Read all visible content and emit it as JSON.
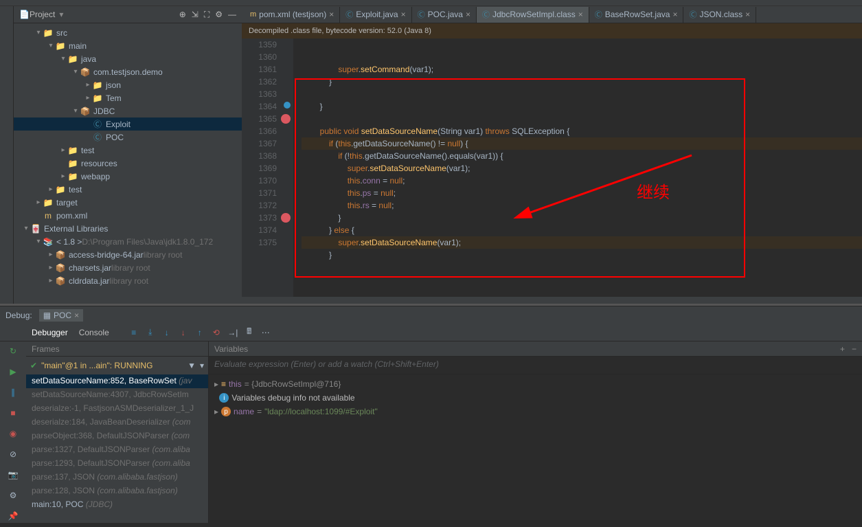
{
  "sidebar": {
    "title": "Project",
    "tree": [
      {
        "indent": 0,
        "arrow": "▾",
        "ico": "📁",
        "cls": "folder-open",
        "label": "src"
      },
      {
        "indent": 1,
        "arrow": "▾",
        "ico": "📁",
        "cls": "folder-open",
        "label": "main"
      },
      {
        "indent": 2,
        "arrow": "▾",
        "ico": "📁",
        "cls": "java-dir",
        "label": "java"
      },
      {
        "indent": 3,
        "arrow": "▾",
        "ico": "📦",
        "cls": "java-dir",
        "label": "com.testjson.demo"
      },
      {
        "indent": 4,
        "arrow": "▸",
        "ico": "📁",
        "cls": "folder",
        "label": "json"
      },
      {
        "indent": 4,
        "arrow": "▸",
        "ico": "📁",
        "cls": "folder",
        "label": "Tem"
      },
      {
        "indent": 3,
        "arrow": "▾",
        "ico": "📦",
        "cls": "java-dir",
        "label": "JDBC"
      },
      {
        "indent": 4,
        "arrow": "",
        "ico": "Ⓒ",
        "cls": "jfile",
        "label": "Exploit",
        "sel": true
      },
      {
        "indent": 4,
        "arrow": "",
        "ico": "Ⓒ",
        "cls": "jfile",
        "label": "POC"
      },
      {
        "indent": 2,
        "arrow": "▸",
        "ico": "📁",
        "cls": "folder",
        "label": "test"
      },
      {
        "indent": 2,
        "arrow": "",
        "ico": "📁",
        "cls": "folder",
        "label": "resources"
      },
      {
        "indent": 2,
        "arrow": "▸",
        "ico": "📁",
        "cls": "folder",
        "label": "webapp"
      },
      {
        "indent": 1,
        "arrow": "▸",
        "ico": "📁",
        "cls": "folder",
        "label": "test"
      },
      {
        "indent": 0,
        "arrow": "▸",
        "ico": "📁",
        "cls": "lname",
        "label": "target"
      },
      {
        "indent": 0,
        "arrow": "",
        "ico": "m",
        "cls": "mvn",
        "label": "pom.xml"
      },
      {
        "indent": -1,
        "arrow": "▾",
        "ico": "🀄",
        "cls": "lib",
        "label": "External Libraries",
        "top": true
      },
      {
        "indent": 0,
        "arrow": "▾",
        "ico": "📚",
        "cls": "lib",
        "label": "< 1.8 >",
        "path": "D:\\Program Files\\Java\\jdk1.8.0_172"
      },
      {
        "indent": 1,
        "arrow": "▸",
        "ico": "📦",
        "cls": "lib",
        "label": "access-bridge-64.jar",
        "dim": "library root"
      },
      {
        "indent": 1,
        "arrow": "▸",
        "ico": "📦",
        "cls": "lib",
        "label": "charsets.jar",
        "dim": "library root"
      },
      {
        "indent": 1,
        "arrow": "▸",
        "ico": "📦",
        "cls": "lib",
        "label": "cldrdata.jar",
        "dim": "library root"
      }
    ]
  },
  "tabs": [
    {
      "ico": "m",
      "cls": "mvn",
      "label": "pom.xml (testjson)"
    },
    {
      "ico": "Ⓒ",
      "cls": "jfile",
      "label": "Exploit.java"
    },
    {
      "ico": "Ⓒ",
      "cls": "jfile",
      "label": "POC.java"
    },
    {
      "ico": "Ⓒ",
      "cls": "jfile",
      "label": "JdbcRowSetImpl.class",
      "active": true
    },
    {
      "ico": "Ⓒ",
      "cls": "jfile",
      "label": "BaseRowSet.java"
    },
    {
      "ico": "Ⓒ",
      "cls": "jfile",
      "label": "JSON.class"
    }
  ],
  "banner": "Decompiled .class file, bytecode version: 52.0 (Java 8)",
  "gutter_start": 1359,
  "gutter_count": 17,
  "code_lines": [
    {
      "html": "                <span class='kw'>super</span>.<span class='fn'>setCommand</span>(var1);"
    },
    {
      "html": "            }"
    },
    {
      "html": ""
    },
    {
      "html": "        }"
    },
    {
      "html": ""
    },
    {
      "html": "        <span class='kw'>public void</span> <span class='fn'>setDataSourceName</span>(String var1) <span class='kw'>throws</span> SQLException {"
    },
    {
      "html": "            <span class='kw'>if</span> (<span class='kw'>this</span>.getDataSourceName() != <span class='lit'>null</span>) {",
      "hl": true
    },
    {
      "html": "                <span class='kw'>if</span> (!<span class='kw'>this</span>.getDataSourceName().equals(var1)) {"
    },
    {
      "html": "                    <span class='kw'>super</span>.<span class='fn'>setDataSourceName</span>(var1);"
    },
    {
      "html": "                    <span class='kw'>this</span>.<span class='id'>conn</span> = <span class='lit'>null</span>;"
    },
    {
      "html": "                    <span class='kw'>this</span>.<span class='id'>ps</span> = <span class='lit'>null</span>;"
    },
    {
      "html": "                    <span class='kw'>this</span>.<span class='id'>rs</span> = <span class='lit'>null</span>;"
    },
    {
      "html": "                }"
    },
    {
      "html": "            } <span class='kw'>else</span> {"
    },
    {
      "html": "                <span class='kw'>super</span>.<span class='fn'>setDataSourceName</span>(var1);",
      "hl": true
    },
    {
      "html": "            }"
    },
    {
      "html": ""
    }
  ],
  "annotation": "继续",
  "debug": {
    "title": "Debug:",
    "tab": "POC",
    "tabs": [
      "Debugger",
      "Console"
    ],
    "frames_title": "Frames",
    "vars_title": "Variables",
    "frame_sel": "\"main\"@1 in ...ain\": RUNNING",
    "frames": [
      {
        "label": "setDataSourceName:852, BaseRowSet",
        "pkg": "(jav",
        "sel": true
      },
      {
        "label": "setDataSourceName:4307, JdbcRowSetIm",
        "dim": true
      },
      {
        "label": "deserialze:-1, FastjsonASMDeserializer_1_J",
        "dim": true
      },
      {
        "label": "deserialze:184, JavaBeanDeserializer",
        "pkg": "(com",
        "dim": true
      },
      {
        "label": "parseObject:368, DefaultJSONParser",
        "pkg": "(com",
        "dim": true
      },
      {
        "label": "parse:1327, DefaultJSONParser",
        "pkg": "(com.aliba",
        "dim": true
      },
      {
        "label": "parse:1293, DefaultJSONParser",
        "pkg": "(com.aliba",
        "dim": true
      },
      {
        "label": "parse:137, JSON",
        "pkg": "(com.alibaba.fastjson)",
        "dim": true
      },
      {
        "label": "parse:128, JSON",
        "pkg": "(com.alibaba.fastjson)",
        "dim": true
      },
      {
        "label": "main:10, POC",
        "pkg": "(JDBC)"
      }
    ],
    "var_hint": "Evaluate expression (Enter) or add a watch (Ctrl+Shift+Enter)",
    "vars": [
      {
        "arrow": "▸",
        "ico": "eq",
        "name": "this",
        "val": "= {JdbcRowSetImpl@716}"
      },
      {
        "arrow": "",
        "ico": "i",
        "name": "",
        "val": "Variables debug info not available",
        "info": true
      },
      {
        "arrow": "▸",
        "ico": "p",
        "name": "name",
        "val": "= \"ldap://localhost:1099/#Exploit\""
      }
    ]
  }
}
